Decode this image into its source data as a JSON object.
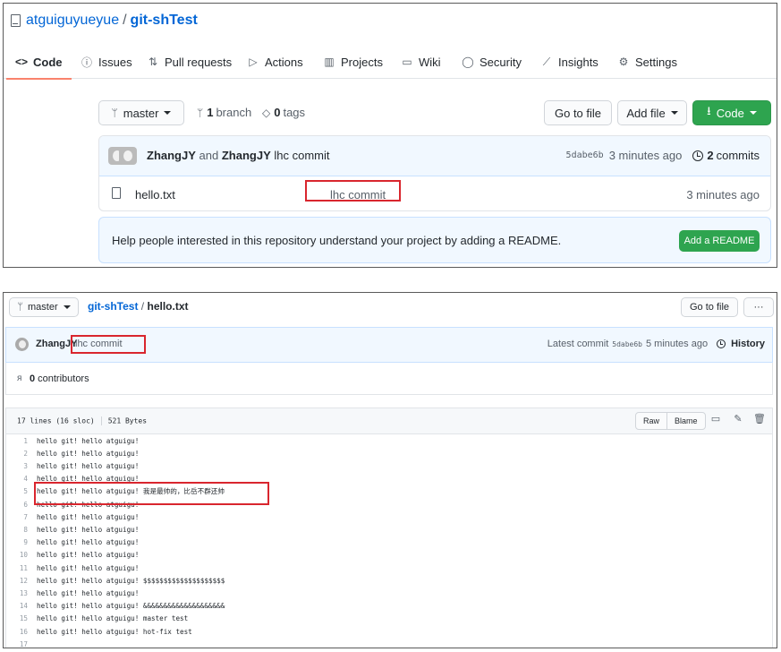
{
  "top": {
    "repo": {
      "owner": "atguiguyueyue",
      "separator": "/",
      "name": "git-shTest"
    },
    "tabs": [
      {
        "label": "Code",
        "icon": "code-icon"
      },
      {
        "label": "Issues",
        "icon": "issue-icon"
      },
      {
        "label": "Pull requests",
        "icon": "pull-request-icon"
      },
      {
        "label": "Actions",
        "icon": "play-icon"
      },
      {
        "label": "Projects",
        "icon": "project-icon"
      },
      {
        "label": "Wiki",
        "icon": "book-icon"
      },
      {
        "label": "Security",
        "icon": "shield-icon"
      },
      {
        "label": "Insights",
        "icon": "graph-icon"
      },
      {
        "label": "Settings",
        "icon": "gear-icon"
      }
    ],
    "branch_button": "master",
    "branches": {
      "count": "1",
      "label": "branch"
    },
    "tags": {
      "count": "0",
      "label": "tags"
    },
    "go_to_file": "Go to file",
    "add_file": "Add file",
    "code_button": "Code",
    "commit": {
      "author1": "ZhangJY",
      "joiner": "and",
      "author2": "ZhangJY",
      "message": "lhc commit",
      "sha": "5dabe6b",
      "age": "3 minutes ago",
      "commits_count": "2",
      "commits_label": "commits"
    },
    "file": {
      "name": "hello.txt",
      "message": "lhc commit",
      "age": "3 minutes ago"
    },
    "readme": {
      "text": "Help people interested in this repository understand your project by adding a README.",
      "button": "Add a README"
    }
  },
  "bottom": {
    "branch_button": "master",
    "breadcrumb": {
      "repo": "git-shTest",
      "separator": "/",
      "file": "hello.txt"
    },
    "go_to_file": "Go to file",
    "more_button": "···",
    "commit": {
      "author": "ZhangJY",
      "message": "lhc commit",
      "latest_label": "Latest commit",
      "sha": "5dabe6b",
      "age": "5 minutes ago",
      "history": "History"
    },
    "contributors": {
      "count": "0",
      "label": "contributors"
    },
    "file_info": {
      "lines": "17 lines (16 sloc)",
      "size": "521 Bytes"
    },
    "raw": "Raw",
    "blame": "Blame",
    "lines": [
      {
        "n": "1",
        "text": "hello git! hello atguigu!"
      },
      {
        "n": "2",
        "text": "hello git! hello atguigu!"
      },
      {
        "n": "3",
        "text": "hello git! hello atguigu!"
      },
      {
        "n": "4",
        "text": "hello git! hello atguigu!"
      },
      {
        "n": "5",
        "text": "hello git! hello atguigu! 我是最帅的，比岳不群还帅"
      },
      {
        "n": "6",
        "text": "hello git! hello atguigu!"
      },
      {
        "n": "7",
        "text": "hello git! hello atguigu!"
      },
      {
        "n": "8",
        "text": "hello git! hello atguigu!"
      },
      {
        "n": "9",
        "text": "hello git! hello atguigu!"
      },
      {
        "n": "10",
        "text": "hello git! hello atguigu!"
      },
      {
        "n": "11",
        "text": "hello git! hello atguigu!"
      },
      {
        "n": "12",
        "text": "hello git! hello atguigu! $$$$$$$$$$$$$$$$$$$$"
      },
      {
        "n": "13",
        "text": "hello git! hello atguigu!"
      },
      {
        "n": "14",
        "text": "hello git! hello atguigu! &&&&&&&&&&&&&&&&&&&&"
      },
      {
        "n": "15",
        "text": "hello git! hello atguigu! master test"
      },
      {
        "n": "16",
        "text": "hello git! hello atguigu! hot-fix test"
      },
      {
        "n": "17",
        "text": ""
      }
    ]
  },
  "colors": {
    "link": "#0366d6",
    "green_button": "#2ea44f",
    "highlight_box": "#d9262e",
    "active_tab_underline": "#f9826c",
    "commit_bar_bg": "#f1f8ff"
  }
}
